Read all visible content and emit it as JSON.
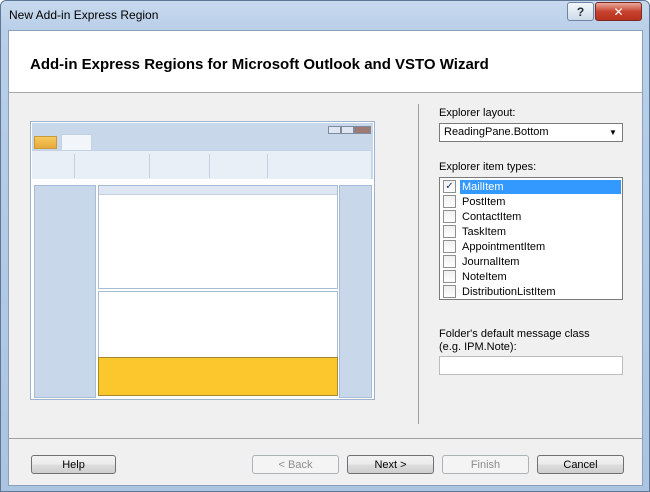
{
  "window": {
    "title": "New Add-in Express Region",
    "help_symbol": "?",
    "close_symbol": "✕"
  },
  "header": {
    "title": "Add-in Express Regions for Microsoft Outlook and VSTO Wizard"
  },
  "explorer_layout": {
    "label": "Explorer layout:",
    "selected": "ReadingPane.Bottom",
    "arrow": "▼"
  },
  "item_types": {
    "label": "Explorer item types:",
    "items": [
      {
        "label": "MailItem",
        "checked": true,
        "selected": true
      },
      {
        "label": "PostItem",
        "checked": false,
        "selected": false
      },
      {
        "label": "ContactItem",
        "checked": false,
        "selected": false
      },
      {
        "label": "TaskItem",
        "checked": false,
        "selected": false
      },
      {
        "label": "AppointmentItem",
        "checked": false,
        "selected": false
      },
      {
        "label": "JournalItem",
        "checked": false,
        "selected": false
      },
      {
        "label": "NoteItem",
        "checked": false,
        "selected": false
      },
      {
        "label": "DistributionListItem",
        "checked": false,
        "selected": false
      }
    ]
  },
  "message_class": {
    "label_line1": "Folder's default message class",
    "label_line2": "(e.g. IPM.Note):",
    "value": ""
  },
  "buttons": {
    "help": "Help",
    "back": "< Back",
    "next": "Next >",
    "finish": "Finish",
    "cancel": "Cancel"
  },
  "colors": {
    "region_highlight": "#fbc72c",
    "selection": "#3399ff"
  }
}
